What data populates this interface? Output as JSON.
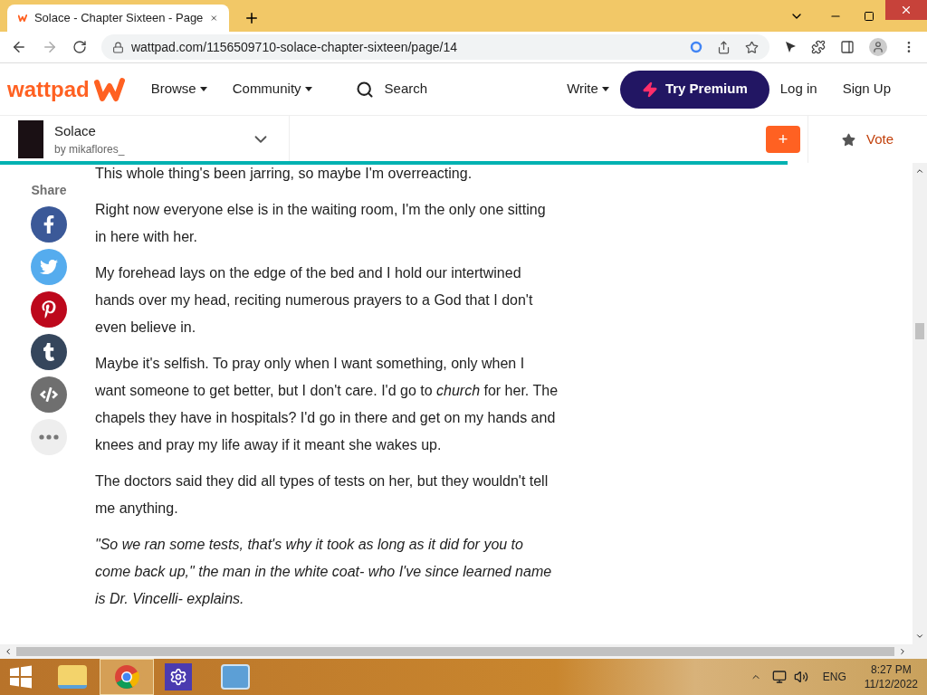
{
  "browser": {
    "tab_title": "Solace - Chapter Sixteen - Page",
    "url": "wattpad.com/1156509710-solace-chapter-sixteen/page/14"
  },
  "header": {
    "logo": "wattpad",
    "nav": [
      {
        "label": "Browse"
      },
      {
        "label": "Community"
      }
    ],
    "search": "Search",
    "write": "Write",
    "premium": "Try Premium",
    "login": "Log in",
    "signup": "Sign Up"
  },
  "story": {
    "title": "Solace",
    "author": "by mikaflores_",
    "add": "+",
    "vote": "Vote",
    "progress": {
      "level": 0.85
    }
  },
  "share": {
    "label": "Share",
    "items": [
      {
        "kind": "facebook"
      },
      {
        "kind": "twitter"
      },
      {
        "kind": "pinterest"
      },
      {
        "kind": "tumblr"
      },
      {
        "kind": "embed"
      },
      {
        "kind": "more"
      }
    ]
  },
  "paragraphs": [
    {
      "kind": "normal",
      "text": "This whole thing's been jarring, so maybe I'm overreacting."
    },
    {
      "kind": "normal",
      "text": "Right now everyone else is in the waiting room, I'm the only one sitting in here with her."
    },
    {
      "kind": "normal",
      "text": "My forehead lays on the edge of the bed and I hold our intertwined hands over my head, reciting numerous prayers to a God that I don't even believe in."
    },
    {
      "kind": "normal",
      "text": "Maybe it's selfish. To pray only when I want something, only when I want someone to get better, but I don't care. I'd go to *church* for her. The chapels they have in hospitals? I'd go in there and get on my hands and knees and pray my life away if it meant she wakes up."
    },
    {
      "kind": "normal",
      "text": "The doctors said they did all types of tests on her, but they wouldn't tell me anything."
    },
    {
      "kind": "italic",
      "text": "\"So we ran some tests, that's why it took as long as it did for you to come back up,\" the man in the white coat- who I've since learned name is Dr. Vincelli- explains."
    }
  ],
  "taskbar": {
    "language": "ENG",
    "time": "8:27 PM",
    "date": "11/12/2022"
  }
}
